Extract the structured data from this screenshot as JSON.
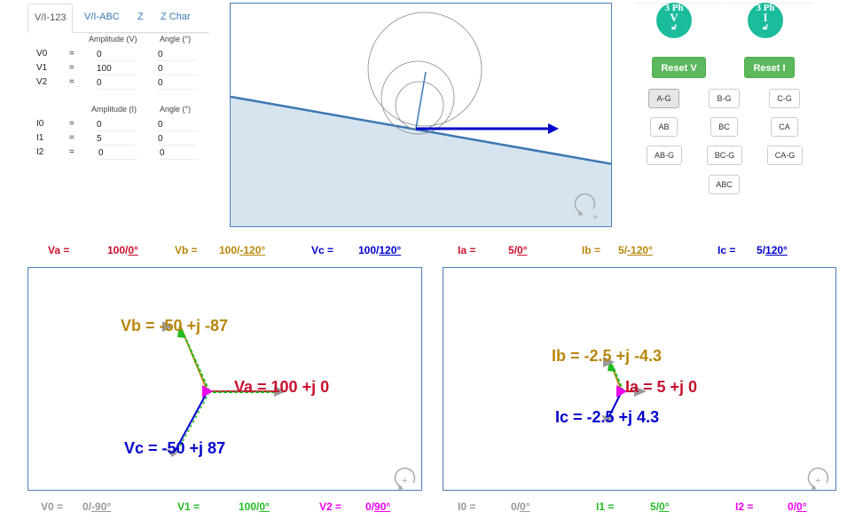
{
  "tabs": [
    "V/I-123",
    "V/I-ABC",
    "Z",
    "Z Char"
  ],
  "active_tab": "V/I-123",
  "voltage_table": {
    "amp_header": "Amplitude (V)",
    "ang_header": "Angle (°)",
    "rows": [
      {
        "label": "V0",
        "eq": "=",
        "amp": "0",
        "ang": "0"
      },
      {
        "label": "V1",
        "eq": "=",
        "amp": "100",
        "ang": "0"
      },
      {
        "label": "V2",
        "eq": "=",
        "amp": "0",
        "ang": "0"
      }
    ]
  },
  "current_table": {
    "amp_header": "Amplitude (I)",
    "ang_header": "Angle (°)",
    "rows": [
      {
        "label": "I0",
        "eq": "=",
        "amp": "0",
        "ang": "0"
      },
      {
        "label": "I1",
        "eq": "=",
        "amp": "5",
        "ang": "0"
      },
      {
        "label": "I2",
        "eq": "=",
        "amp": "0",
        "ang": "0"
      }
    ]
  },
  "controls": {
    "v3ph": {
      "top": "3 Ph",
      "letter": "V"
    },
    "i3ph": {
      "top": "3 Ph",
      "letter": "I"
    },
    "reset_v": "Reset V",
    "reset_i": "Reset I",
    "faults": [
      "A-G",
      "B-G",
      "C-G",
      "AB",
      "BC",
      "CA",
      "AB-G",
      "BC-G",
      "CA-G",
      "ABC"
    ],
    "selected_fault": "A-G"
  },
  "phase_values": {
    "va": {
      "label": "Va =",
      "mag": "100",
      "ang": "0°"
    },
    "vb": {
      "label": "Vb =",
      "mag": "100",
      "ang": "-120°"
    },
    "vc": {
      "label": "Vc =",
      "mag": "100",
      "ang": "120°"
    },
    "ia": {
      "label": "Ia =",
      "mag": "5",
      "ang": "0°"
    },
    "ib": {
      "label": "Ib =",
      "mag": "5",
      "ang": "-120°"
    },
    "ic": {
      "label": "Ic =",
      "mag": "5",
      "ang": "120°"
    }
  },
  "voltage_phasors": {
    "va": "Va = 100 +j 0",
    "vb": "Vb = -50 +j -87",
    "vc": "Vc = -50 +j 87"
  },
  "current_phasors": {
    "ia": "Ia = 5 +j 0",
    "ib": "Ib = -2.5 +j -4.3",
    "ic": "Ic = -2.5 +j 4.3"
  },
  "sequence_values": {
    "v0": {
      "label": "V0 =",
      "mag": "0",
      "ang": "-90°"
    },
    "v1": {
      "label": "V1 =",
      "mag": "100",
      "ang": "0°"
    },
    "v2": {
      "label": "V2 =",
      "mag": "0",
      "ang": "90°"
    },
    "i0": {
      "label": "I0 =",
      "mag": "0",
      "ang": "0°"
    },
    "i1": {
      "label": "I1 =",
      "mag": "5",
      "ang": "0°"
    },
    "i2": {
      "label": "I2 =",
      "mag": "0",
      "ang": "0°"
    }
  },
  "colors": {
    "phase_a": "#c8102e",
    "phase_b": "#b8860b",
    "phase_c": "#0000cc",
    "seq_0": "#999999",
    "seq_1": "#22bb22",
    "seq_2": "#ee00ee",
    "accent": "#1abc9c",
    "button_green": "#5cb85c"
  }
}
